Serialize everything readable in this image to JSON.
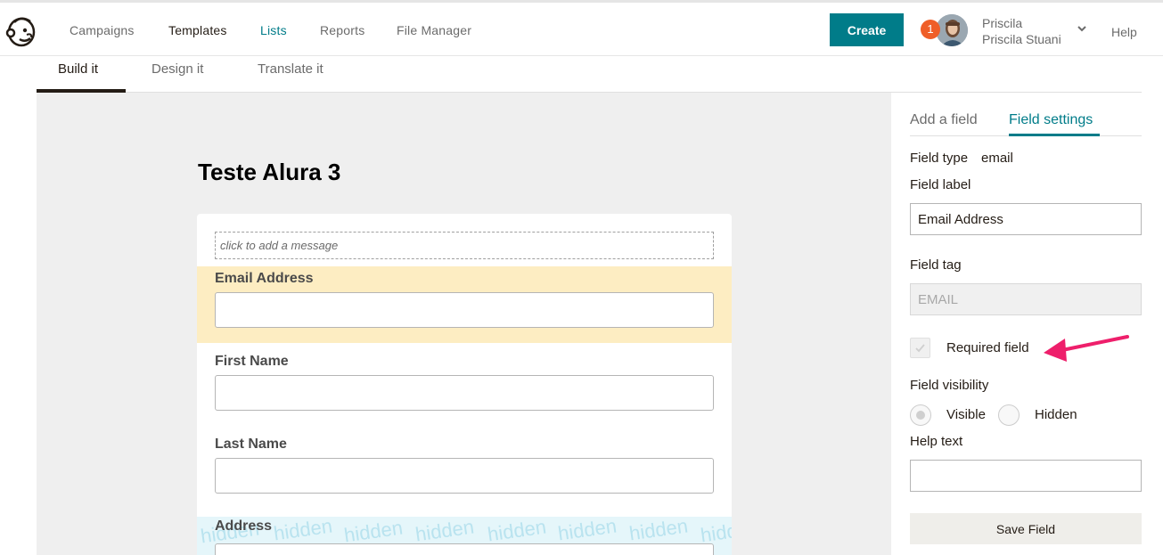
{
  "nav": {
    "items": [
      "Campaigns",
      "Templates",
      "Lists",
      "Reports",
      "File Manager"
    ],
    "create_label": "Create",
    "notification_count": "1",
    "user_first": "Priscila",
    "user_full": "Priscila Stuani",
    "help_label": "Help"
  },
  "subtabs": [
    "Build it",
    "Design it",
    "Translate it"
  ],
  "form": {
    "title": "Teste Alura 3",
    "message_placeholder": "click to add a message",
    "fields": [
      {
        "label": "Email Address"
      },
      {
        "label": "First Name"
      },
      {
        "label": "Last Name"
      },
      {
        "label": "Address"
      }
    ],
    "hidden_watermark": "hidden"
  },
  "panel": {
    "tabs": [
      "Add a field",
      "Field settings"
    ],
    "field_type_label": "Field type",
    "field_type_value": "email",
    "field_label_label": "Field label",
    "field_label_value": "Email Address",
    "field_tag_label": "Field tag",
    "field_tag_value": "EMAIL",
    "required_label": "Required field",
    "visibility_label": "Field visibility",
    "visible_label": "Visible",
    "hidden_label": "Hidden",
    "help_text_label": "Help text",
    "help_text_value": "",
    "save_label": "Save Field"
  },
  "colors": {
    "accent": "#007c89",
    "badge": "#ef5e28",
    "selected_field": "#fdedc2",
    "hidden_field": "#e5f6fa",
    "annotation": "#ee1f6b"
  }
}
